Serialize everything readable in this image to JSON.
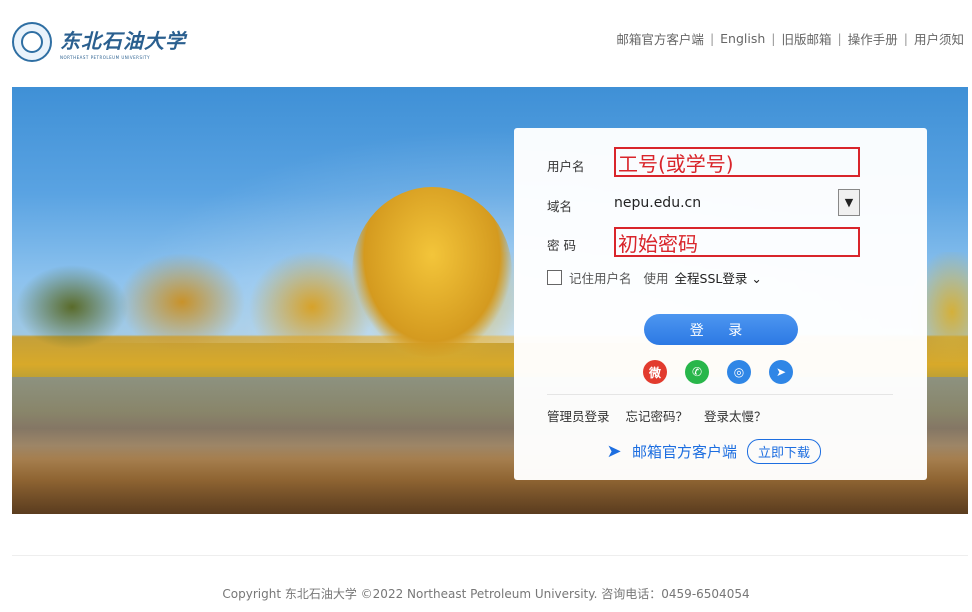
{
  "header": {
    "logo_cn": "东北石油大学",
    "logo_en": "NORTHEAST PETROLEUM UNIVERSITY",
    "nav": [
      "邮箱官方客户端",
      "English",
      "旧版邮箱",
      "操作手册",
      "用户须知"
    ]
  },
  "login": {
    "username_label": "用户名",
    "username_value": "工号(或学号)",
    "domain_label": "域名",
    "domain_value": "nepu.edu.cn",
    "password_label": "密 码",
    "password_value": "初始密码",
    "remember_label": "记住用户名",
    "use_label": "使用",
    "ssl_label": "全程SSL登录",
    "login_button": "登 录",
    "social_icons": [
      "weibo-icon",
      "wechat-icon",
      "qq-icon",
      "other-login-icon"
    ],
    "links": [
      "管理员登录",
      "忘记密码？",
      "登录太慢？"
    ],
    "client_label": "邮箱官方客户端",
    "download_button": "立即下载"
  },
  "footer": {
    "copyright": "Copyright 东北石油大学 ©2022 Northeast Petroleum University. 咨询电话：0459-6504054"
  },
  "colors": {
    "accent": "#2c79e4",
    "annotation_red": "#d9252b"
  }
}
